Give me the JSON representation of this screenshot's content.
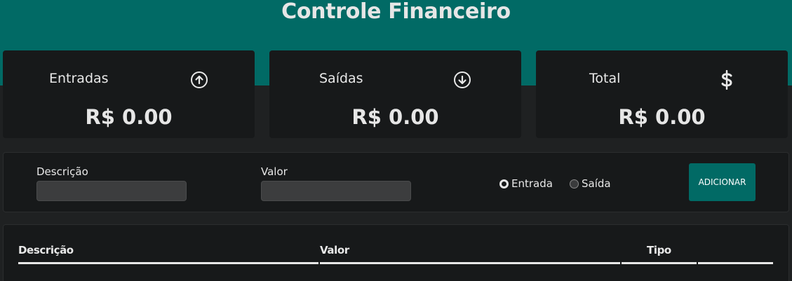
{
  "header": {
    "title": "Controle Financeiro"
  },
  "summary": {
    "income": {
      "label": "Entradas",
      "value": "R$ 0.00",
      "icon": "arrow-up-circle-icon"
    },
    "expense": {
      "label": "Saídas",
      "value": "R$ 0.00",
      "icon": "arrow-down-circle-icon"
    },
    "total": {
      "label": "Total",
      "value": "R$ 0.00",
      "icon": "dollar-icon"
    }
  },
  "form": {
    "description_label": "Descrição",
    "description_value": "",
    "amount_label": "Valor",
    "amount_value": "",
    "type_options": [
      {
        "label": "Entrada",
        "selected": true
      },
      {
        "label": "Saída",
        "selected": false
      }
    ],
    "add_button": "ADICIONAR"
  },
  "table": {
    "columns": [
      "Descrição",
      "Valor",
      "Tipo",
      ""
    ],
    "rows": []
  },
  "colors": {
    "accent": "#016a65",
    "background": "#1f2122",
    "card": "#17191a",
    "input": "#3c3d3e"
  }
}
